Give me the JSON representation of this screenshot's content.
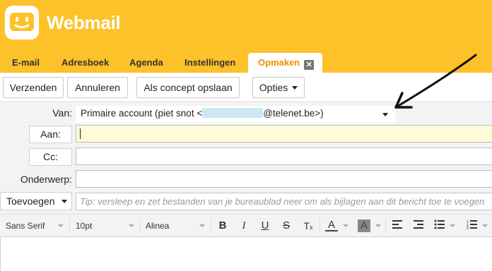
{
  "app": {
    "brand": "Webmail",
    "accent_color": "#fdc129",
    "active_tab_color": "#f28c00",
    "logo_icon": "smiley-icon"
  },
  "tabs": [
    {
      "label": "E-mail"
    },
    {
      "label": "Adresboek"
    },
    {
      "label": "Agenda"
    },
    {
      "label": "Instellingen"
    },
    {
      "label": "Opmaken",
      "active": true,
      "close_icon": "close-icon"
    }
  ],
  "toolbar": {
    "send_label": "Verzenden",
    "cancel_label": "Annuleren",
    "draft_label": "Als concept opslaan",
    "options_label": "Opties"
  },
  "form": {
    "from_label": "Van:",
    "from_value_prefix": "Primaire account (piet snot <",
    "from_value_suffix": "@telenet.be>)",
    "to_label": "Aan:",
    "to_value": "",
    "cc_label": "Cc:",
    "cc_value": "",
    "subject_label": "Onderwerp:",
    "subject_value": "",
    "attach_label": "Toevoegen",
    "attach_hint": "Tip: versleep en zet bestanden van je bureaublad neer om als bijlagen aan dit bericht toe te voegen"
  },
  "editor_toolbar": {
    "font_family": "Sans Serif",
    "font_size": "10pt",
    "align": "Alinea"
  },
  "annotation": {
    "arrow_icon": "arrow-pointer-icon"
  }
}
